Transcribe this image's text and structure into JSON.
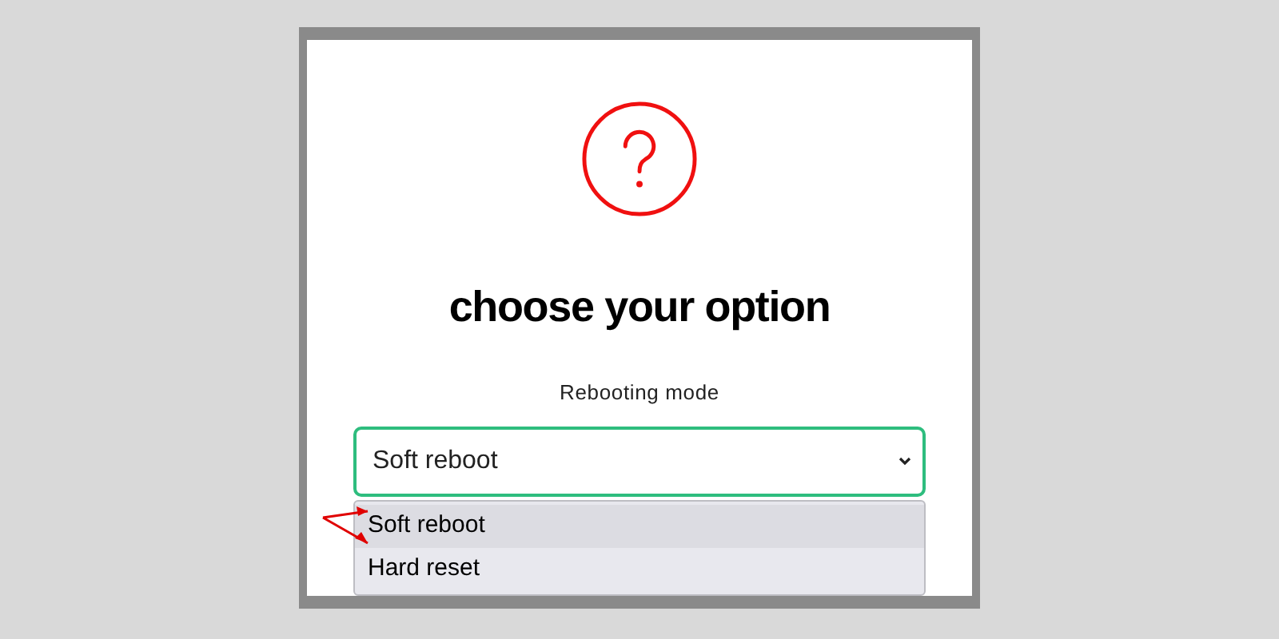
{
  "dialog": {
    "title": "choose your option",
    "field_label": "Rebooting mode",
    "select": {
      "value": "Soft reboot",
      "expanded": true
    },
    "options": [
      {
        "label": "Soft reboot",
        "selected": true
      },
      {
        "label": "Hard reset",
        "selected": false
      }
    ]
  }
}
